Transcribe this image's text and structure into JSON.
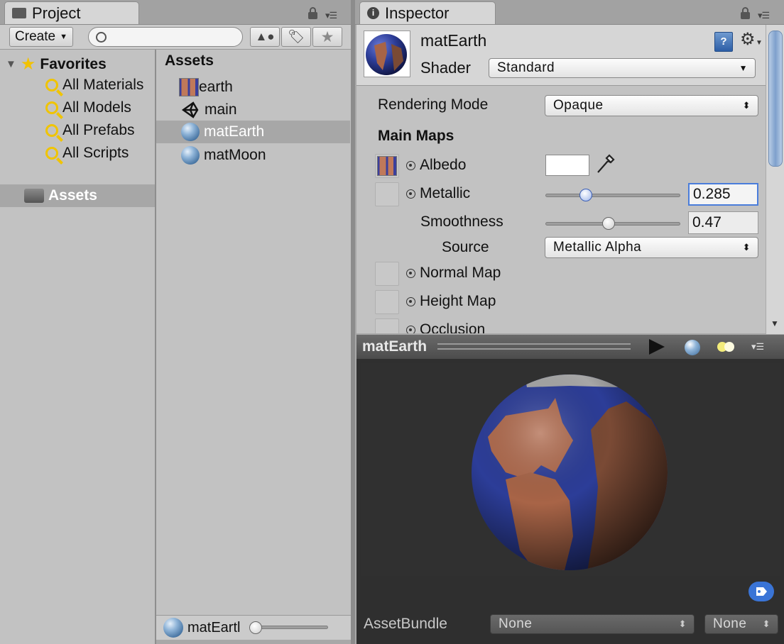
{
  "project": {
    "tab_title": "Project",
    "create_label": "Create",
    "search": {
      "value": "",
      "placeholder": ""
    },
    "favorites": {
      "label": "Favorites",
      "items": [
        "All Materials",
        "All Models",
        "All Prefabs",
        "All Scripts"
      ]
    },
    "root_folder": "Assets",
    "assets_header": "Assets",
    "assets": [
      {
        "name": "earth",
        "icon": "texture-icon"
      },
      {
        "name": "main",
        "icon": "unity-scene-icon"
      },
      {
        "name": "matEarth",
        "icon": "material-icon",
        "selected": true
      },
      {
        "name": "matMoon",
        "icon": "material-icon"
      }
    ],
    "footer_selected": "matEartl"
  },
  "inspector": {
    "tab_title": "Inspector",
    "material_name": "matEarth",
    "shader_label": "Shader",
    "shader_value": "Standard",
    "rendering_mode_label": "Rendering Mode",
    "rendering_mode_value": "Opaque",
    "main_maps_label": "Main Maps",
    "albedo_label": "Albedo",
    "albedo_color": "#ffffff",
    "metallic_label": "Metallic",
    "metallic_value": "0.285",
    "smoothness_label": "Smoothness",
    "smoothness_value": "0.47",
    "source_label": "Source",
    "source_value": "Metallic Alpha",
    "normal_map_label": "Normal Map",
    "height_map_label": "Height Map",
    "occlusion_label": "Occlusion"
  },
  "preview": {
    "title": "matEarth",
    "assetbundle_label": "AssetBundle",
    "assetbundle_value": "None",
    "variant_value": "None"
  },
  "colors": {
    "selection": "#a7a7a7",
    "ocean": "#2c3d98",
    "land": "#b06a4d",
    "accent_focus": "#4a7ddb"
  }
}
